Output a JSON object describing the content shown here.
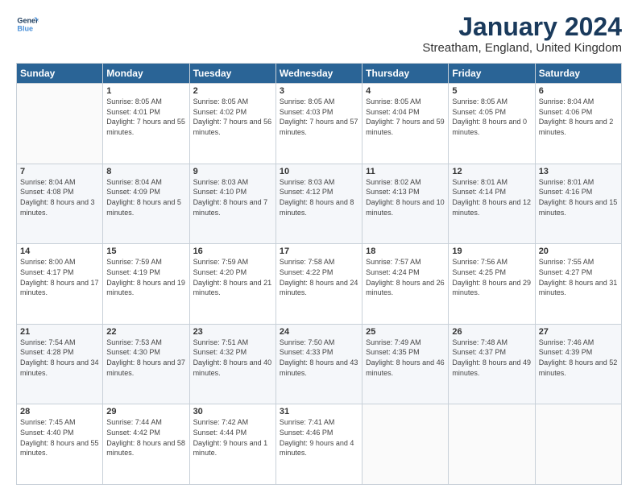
{
  "logo": {
    "line1": "General",
    "line2": "Blue"
  },
  "title": "January 2024",
  "subtitle": "Streatham, England, United Kingdom",
  "days": [
    "Sunday",
    "Monday",
    "Tuesday",
    "Wednesday",
    "Thursday",
    "Friday",
    "Saturday"
  ],
  "weeks": [
    [
      {
        "day": "",
        "sunrise": "",
        "sunset": "",
        "daylight": ""
      },
      {
        "day": "1",
        "sunrise": "8:05 AM",
        "sunset": "4:01 PM",
        "daylight": "7 hours and 55 minutes."
      },
      {
        "day": "2",
        "sunrise": "8:05 AM",
        "sunset": "4:02 PM",
        "daylight": "7 hours and 56 minutes."
      },
      {
        "day": "3",
        "sunrise": "8:05 AM",
        "sunset": "4:03 PM",
        "daylight": "7 hours and 57 minutes."
      },
      {
        "day": "4",
        "sunrise": "8:05 AM",
        "sunset": "4:04 PM",
        "daylight": "7 hours and 59 minutes."
      },
      {
        "day": "5",
        "sunrise": "8:05 AM",
        "sunset": "4:05 PM",
        "daylight": "8 hours and 0 minutes."
      },
      {
        "day": "6",
        "sunrise": "8:04 AM",
        "sunset": "4:06 PM",
        "daylight": "8 hours and 2 minutes."
      }
    ],
    [
      {
        "day": "7",
        "sunrise": "8:04 AM",
        "sunset": "4:08 PM",
        "daylight": "8 hours and 3 minutes."
      },
      {
        "day": "8",
        "sunrise": "8:04 AM",
        "sunset": "4:09 PM",
        "daylight": "8 hours and 5 minutes."
      },
      {
        "day": "9",
        "sunrise": "8:03 AM",
        "sunset": "4:10 PM",
        "daylight": "8 hours and 7 minutes."
      },
      {
        "day": "10",
        "sunrise": "8:03 AM",
        "sunset": "4:12 PM",
        "daylight": "8 hours and 8 minutes."
      },
      {
        "day": "11",
        "sunrise": "8:02 AM",
        "sunset": "4:13 PM",
        "daylight": "8 hours and 10 minutes."
      },
      {
        "day": "12",
        "sunrise": "8:01 AM",
        "sunset": "4:14 PM",
        "daylight": "8 hours and 12 minutes."
      },
      {
        "day": "13",
        "sunrise": "8:01 AM",
        "sunset": "4:16 PM",
        "daylight": "8 hours and 15 minutes."
      }
    ],
    [
      {
        "day": "14",
        "sunrise": "8:00 AM",
        "sunset": "4:17 PM",
        "daylight": "8 hours and 17 minutes."
      },
      {
        "day": "15",
        "sunrise": "7:59 AM",
        "sunset": "4:19 PM",
        "daylight": "8 hours and 19 minutes."
      },
      {
        "day": "16",
        "sunrise": "7:59 AM",
        "sunset": "4:20 PM",
        "daylight": "8 hours and 21 minutes."
      },
      {
        "day": "17",
        "sunrise": "7:58 AM",
        "sunset": "4:22 PM",
        "daylight": "8 hours and 24 minutes."
      },
      {
        "day": "18",
        "sunrise": "7:57 AM",
        "sunset": "4:24 PM",
        "daylight": "8 hours and 26 minutes."
      },
      {
        "day": "19",
        "sunrise": "7:56 AM",
        "sunset": "4:25 PM",
        "daylight": "8 hours and 29 minutes."
      },
      {
        "day": "20",
        "sunrise": "7:55 AM",
        "sunset": "4:27 PM",
        "daylight": "8 hours and 31 minutes."
      }
    ],
    [
      {
        "day": "21",
        "sunrise": "7:54 AM",
        "sunset": "4:28 PM",
        "daylight": "8 hours and 34 minutes."
      },
      {
        "day": "22",
        "sunrise": "7:53 AM",
        "sunset": "4:30 PM",
        "daylight": "8 hours and 37 minutes."
      },
      {
        "day": "23",
        "sunrise": "7:51 AM",
        "sunset": "4:32 PM",
        "daylight": "8 hours and 40 minutes."
      },
      {
        "day": "24",
        "sunrise": "7:50 AM",
        "sunset": "4:33 PM",
        "daylight": "8 hours and 43 minutes."
      },
      {
        "day": "25",
        "sunrise": "7:49 AM",
        "sunset": "4:35 PM",
        "daylight": "8 hours and 46 minutes."
      },
      {
        "day": "26",
        "sunrise": "7:48 AM",
        "sunset": "4:37 PM",
        "daylight": "8 hours and 49 minutes."
      },
      {
        "day": "27",
        "sunrise": "7:46 AM",
        "sunset": "4:39 PM",
        "daylight": "8 hours and 52 minutes."
      }
    ],
    [
      {
        "day": "28",
        "sunrise": "7:45 AM",
        "sunset": "4:40 PM",
        "daylight": "8 hours and 55 minutes."
      },
      {
        "day": "29",
        "sunrise": "7:44 AM",
        "sunset": "4:42 PM",
        "daylight": "8 hours and 58 minutes."
      },
      {
        "day": "30",
        "sunrise": "7:42 AM",
        "sunset": "4:44 PM",
        "daylight": "9 hours and 1 minute."
      },
      {
        "day": "31",
        "sunrise": "7:41 AM",
        "sunset": "4:46 PM",
        "daylight": "9 hours and 4 minutes."
      },
      {
        "day": "",
        "sunrise": "",
        "sunset": "",
        "daylight": ""
      },
      {
        "day": "",
        "sunrise": "",
        "sunset": "",
        "daylight": ""
      },
      {
        "day": "",
        "sunrise": "",
        "sunset": "",
        "daylight": ""
      }
    ]
  ]
}
